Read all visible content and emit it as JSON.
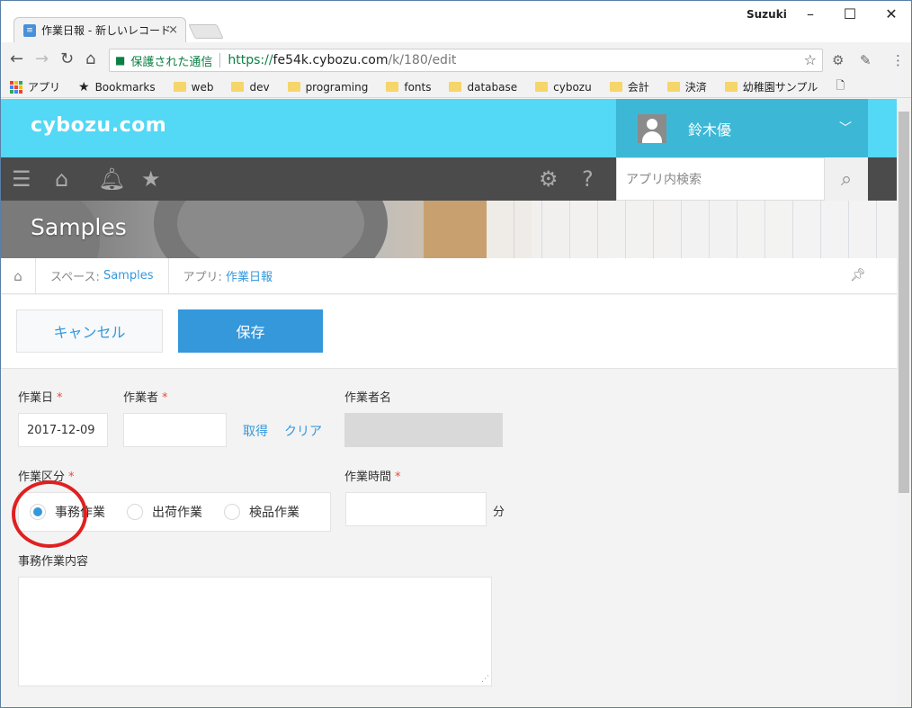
{
  "browser": {
    "tab_title": "作業日報 - 新しいレコード",
    "tab_close": "×",
    "profile_name": "Suzuki",
    "url_secure_label": "保護された通信",
    "url_proto": "https://",
    "url_host": "fe54k.cybozu.com",
    "url_path": "/k/180/edit",
    "bookmarks": [
      "アプリ",
      "Bookmarks",
      "web",
      "dev",
      "programing",
      "fonts",
      "database",
      "cybozu",
      "会計",
      "決済",
      "幼稚園サンプル"
    ]
  },
  "header": {
    "logo": "cybozu.com",
    "user_name": "鈴木優",
    "search_placeholder": "アプリ内検索"
  },
  "banner": {
    "title": "Samples"
  },
  "breadcrumb": {
    "space_prefix": "スペース:",
    "space_name": "Samples",
    "app_prefix": "アプリ:",
    "app_name": "作業日報"
  },
  "actions": {
    "cancel": "キャンセル",
    "save": "保存"
  },
  "form": {
    "work_date_label": "作業日",
    "work_date_value": "2017-12-09",
    "worker_label": "作業者",
    "worker_value": "",
    "fetch_link": "取得",
    "clear_link": "クリア",
    "worker_name_label": "作業者名",
    "category_label": "作業区分",
    "category_options": [
      "事務作業",
      "出荷作業",
      "検品作業"
    ],
    "category_selected": "事務作業",
    "work_time_label": "作業時間",
    "work_time_value": "",
    "work_time_unit": "分",
    "office_work_label": "事務作業内容",
    "required_mark": "*"
  },
  "colors": {
    "accent": "#3498db",
    "header": "#53d8f5",
    "required": "#e74c3c",
    "highlight_circle": "#e02020"
  }
}
